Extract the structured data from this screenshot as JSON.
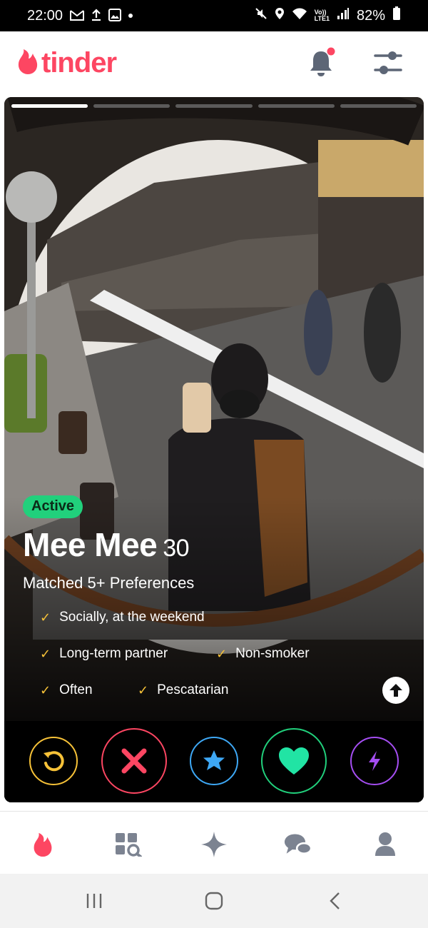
{
  "status_bar": {
    "time": "22:00",
    "left_icons": [
      "gmail-icon",
      "upload-icon",
      "gallery-icon",
      "dot-icon"
    ],
    "right_icons": [
      "mute-icon",
      "location-icon",
      "wifi-icon",
      "volte-icon",
      "signal-icon"
    ],
    "volte_text": "Vo))\nLTE1",
    "battery": "82%"
  },
  "header": {
    "logo_text": "tinder",
    "notification_dot": true
  },
  "profile": {
    "photo_count": 5,
    "photo_index": 1,
    "active_badge": "Active",
    "name": "Mee Mee",
    "age": "30",
    "matched": "Matched 5+ Preferences",
    "tags": [
      "Socially, at the weekend",
      "Long-term partner",
      "Non-smoker",
      "Often",
      "Pescatarian"
    ]
  },
  "actions": [
    "rewind-button",
    "nope-button",
    "super-like-button",
    "like-button",
    "boost-button"
  ],
  "bottom_nav": [
    "tab-home",
    "tab-explore",
    "tab-sparkle",
    "tab-chat",
    "tab-profile"
  ],
  "colors": {
    "brand": "#fd4662",
    "active": "#21d07c",
    "rewind": "#f7c238",
    "nope": "#fd4662",
    "super_like": "#3ea8f5",
    "like": "#21d07c",
    "boost": "#a54ef2",
    "check": "#f7c238"
  }
}
